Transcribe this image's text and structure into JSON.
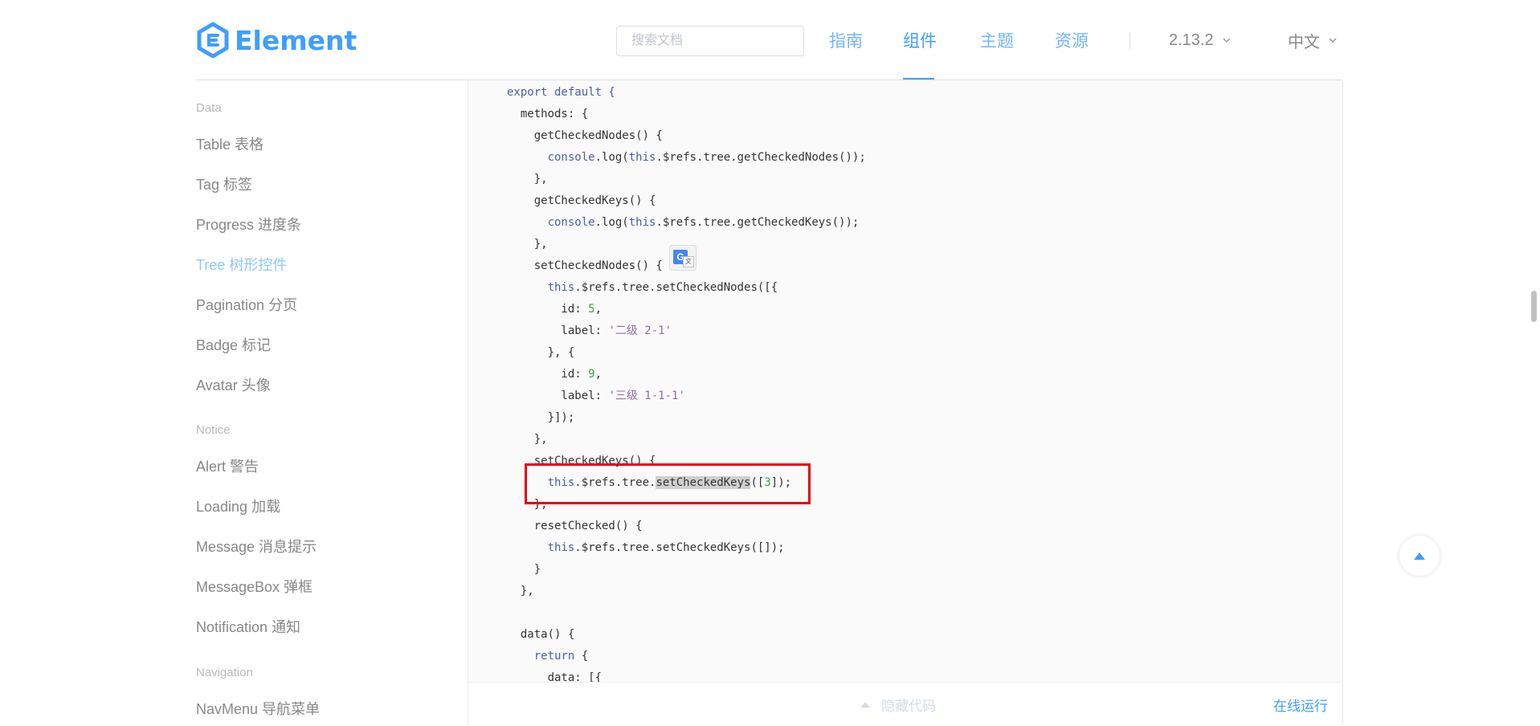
{
  "header": {
    "logo_text": "Element",
    "search_placeholder": "搜索文档",
    "nav": [
      {
        "label": "指南",
        "active": false
      },
      {
        "label": "组件",
        "active": true
      },
      {
        "label": "主题",
        "active": false
      },
      {
        "label": "资源",
        "active": false
      }
    ],
    "version": "2.13.2",
    "language": "中文"
  },
  "sidebar": {
    "groups": [
      {
        "title": "Data",
        "items": [
          "Table 表格",
          "Tag 标签",
          "Progress 进度条",
          "Tree 树形控件",
          "Pagination 分页",
          "Badge 标记",
          "Avatar 头像"
        ]
      },
      {
        "title": "Notice",
        "items": [
          "Alert 警告",
          "Loading 加载",
          "Message 消息提示",
          "MessageBox 弹框",
          "Notification 通知"
        ]
      },
      {
        "title": "Navigation",
        "items": [
          "NavMenu 导航菜单"
        ]
      }
    ],
    "active_item": "Tree 树形控件"
  },
  "code": {
    "lines": [
      "export default {",
      "  methods: {",
      "    getCheckedNodes() {",
      "      console.log(this.$refs.tree.getCheckedNodes());",
      "    },",
      "    getCheckedKeys() {",
      "      console.log(this.$refs.tree.getCheckedKeys());",
      "    },",
      "    setCheckedNodes() {",
      "      this.$refs.tree.setCheckedNodes([{",
      "        id: 5,",
      "        label: '二级 2-1'",
      "      }, {",
      "        id: 9,",
      "        label: '三级 1-1-1'",
      "      }]);",
      "    },",
      "    setCheckedKeys() {",
      "      this.$refs.tree.setCheckedKeys([3]);",
      "    },",
      "    resetChecked() {",
      "      this.$refs.tree.setCheckedKeys([]);",
      "    }",
      "  },",
      "",
      "  data() {",
      "    return {",
      "      data: [{"
    ],
    "highlighted_text": "setCheckedKeys"
  },
  "controls": {
    "hide_code": "隐藏代码",
    "run_online": "在线运行"
  },
  "colors": {
    "accent": "#409eff",
    "annotation": "#e60012"
  }
}
